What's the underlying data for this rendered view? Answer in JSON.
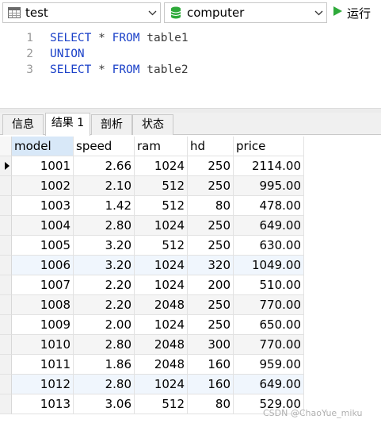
{
  "toolbar": {
    "connection": {
      "label": "test",
      "icon": "connection-table-icon"
    },
    "database": {
      "label": "computer",
      "icon": "database-icon"
    },
    "run": {
      "label": "运行",
      "icon": "play-icon"
    }
  },
  "editor": {
    "lines": [
      {
        "num": "1",
        "tokens": [
          {
            "text": "SELECT",
            "kw": true
          },
          {
            "text": " * ",
            "kw": false
          },
          {
            "text": "FROM",
            "kw": true
          },
          {
            "text": " table1",
            "kw": false
          }
        ]
      },
      {
        "num": "2",
        "tokens": [
          {
            "text": "UNION",
            "kw": true
          }
        ]
      },
      {
        "num": "3",
        "tokens": [
          {
            "text": "SELECT",
            "kw": true
          },
          {
            "text": " * ",
            "kw": false
          },
          {
            "text": "FROM",
            "kw": true
          },
          {
            "text": " table2",
            "kw": false
          }
        ]
      }
    ]
  },
  "tabs": [
    {
      "label": "信息",
      "active": false
    },
    {
      "label": "结果 1",
      "active": true
    },
    {
      "label": "剖析",
      "active": false
    },
    {
      "label": "状态",
      "active": false
    }
  ],
  "table": {
    "columns": [
      "model",
      "speed",
      "ram",
      "hd",
      "price"
    ],
    "rows": [
      [
        "1001",
        "2.66",
        "1024",
        "250",
        "2114.00"
      ],
      [
        "1002",
        "2.10",
        "512",
        "250",
        "995.00"
      ],
      [
        "1003",
        "1.42",
        "512",
        "80",
        "478.00"
      ],
      [
        "1004",
        "2.80",
        "1024",
        "250",
        "649.00"
      ],
      [
        "1005",
        "3.20",
        "512",
        "250",
        "630.00"
      ],
      [
        "1006",
        "3.20",
        "1024",
        "320",
        "1049.00"
      ],
      [
        "1007",
        "2.20",
        "1024",
        "200",
        "510.00"
      ],
      [
        "1008",
        "2.20",
        "2048",
        "250",
        "770.00"
      ],
      [
        "1009",
        "2.00",
        "1024",
        "250",
        "650.00"
      ],
      [
        "1010",
        "2.80",
        "2048",
        "300",
        "770.00"
      ],
      [
        "1011",
        "1.86",
        "2048",
        "160",
        "959.00"
      ],
      [
        "1012",
        "2.80",
        "1024",
        "160",
        "649.00"
      ],
      [
        "1013",
        "3.06",
        "512",
        "80",
        "529.00"
      ]
    ]
  },
  "watermark": "CSDN @ChaoYue_miku",
  "colors": {
    "keyword": "#1a40c8",
    "run_icon": "#2eaa3a",
    "database_icon": "#2eaa3a",
    "selected_header": "#d8e8f8"
  }
}
